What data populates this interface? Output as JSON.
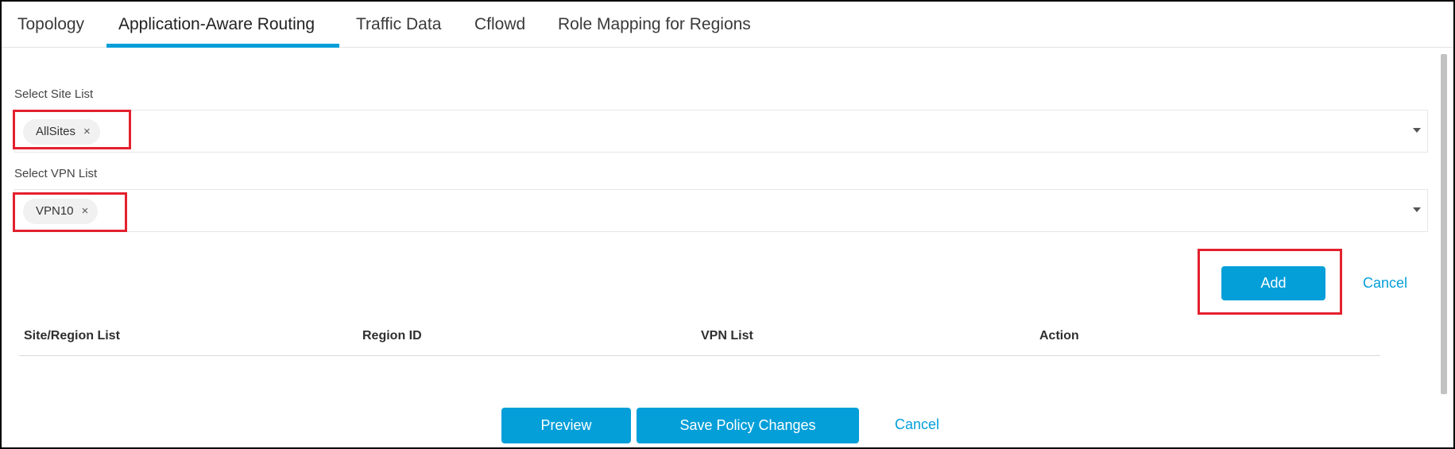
{
  "tabs": [
    {
      "label": "Topology",
      "active": false
    },
    {
      "label": "Application-Aware Routing",
      "active": true
    },
    {
      "label": "Traffic Data",
      "active": false
    },
    {
      "label": "Cflowd",
      "active": false
    },
    {
      "label": "Role Mapping for Regions",
      "active": false
    }
  ],
  "site_list": {
    "label": "Select Site List",
    "selected": [
      "AllSites"
    ],
    "remove_glyph": "×"
  },
  "vpn_list": {
    "label": "Select VPN List",
    "selected": [
      "VPN10"
    ],
    "remove_glyph": "×"
  },
  "actions": {
    "add_label": "Add",
    "cancel_label": "Cancel"
  },
  "table": {
    "columns": [
      "Site/Region List",
      "Region ID",
      "VPN List",
      "Action"
    ],
    "rows": []
  },
  "footer": {
    "preview_label": "Preview",
    "save_label": "Save Policy Changes",
    "cancel_label": "Cancel"
  },
  "colors": {
    "accent": "#049fd9",
    "highlight": "#e3212e"
  },
  "icons": {
    "chip_remove": "close-icon",
    "dropdown": "chevron-down-icon"
  }
}
